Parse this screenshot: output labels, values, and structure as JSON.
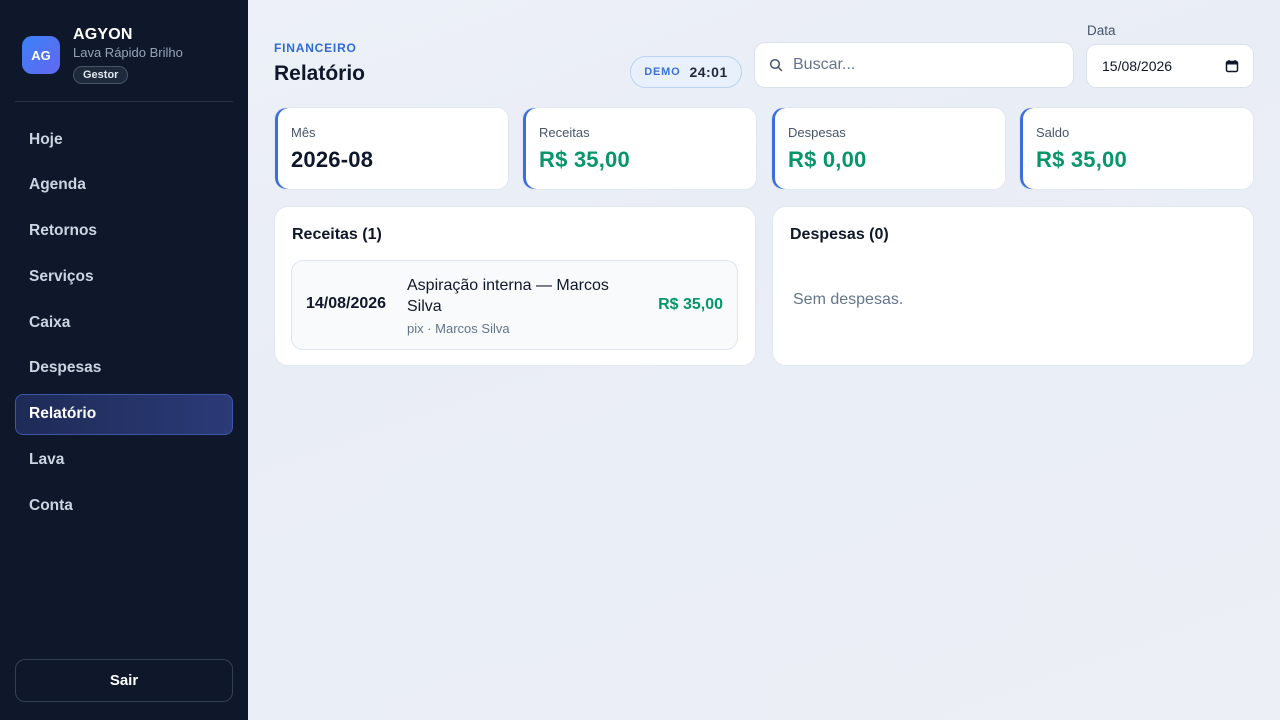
{
  "brand": {
    "avatar": "AG",
    "name": "AGYON",
    "subtitle": "Lava Rápido Brilho",
    "role": "Gestor"
  },
  "sidebar": {
    "items": [
      {
        "label": "Hoje"
      },
      {
        "label": "Agenda"
      },
      {
        "label": "Retornos"
      },
      {
        "label": "Serviços"
      },
      {
        "label": "Caixa"
      },
      {
        "label": "Despesas"
      },
      {
        "label": "Relatório",
        "active": true
      },
      {
        "label": "Lava"
      },
      {
        "label": "Conta"
      }
    ],
    "logout_label": "Sair"
  },
  "header": {
    "eyebrow": "FINANCEIRO",
    "title": "Relatório",
    "demo_label": "DEMO",
    "demo_time": "24:01",
    "search_placeholder": "Buscar...",
    "date_label": "Data",
    "date_value": "15/08/2026"
  },
  "stats": [
    {
      "label": "Mês",
      "value": "2026-08"
    },
    {
      "label": "Receitas",
      "value": "R$ 35,00"
    },
    {
      "label": "Despesas",
      "value": "R$ 0,00"
    },
    {
      "label": "Saldo",
      "value": "R$ 35,00"
    }
  ],
  "receitas": {
    "title": "Receitas (1)",
    "items": [
      {
        "date": "14/08/2026",
        "description": "Aspiração interna — Marcos Silva",
        "meta": "pix · Marcos Silva",
        "amount": "R$ 35,00"
      }
    ]
  },
  "despesas": {
    "title": "Despesas (0)",
    "empty": "Sem despesas."
  },
  "colors": {
    "sidebar_bg": "#0f172a",
    "accent": "#3b6fdc",
    "money": "#059669"
  },
  "icons": {
    "search": "search-icon",
    "calendar": "calendar-icon"
  }
}
